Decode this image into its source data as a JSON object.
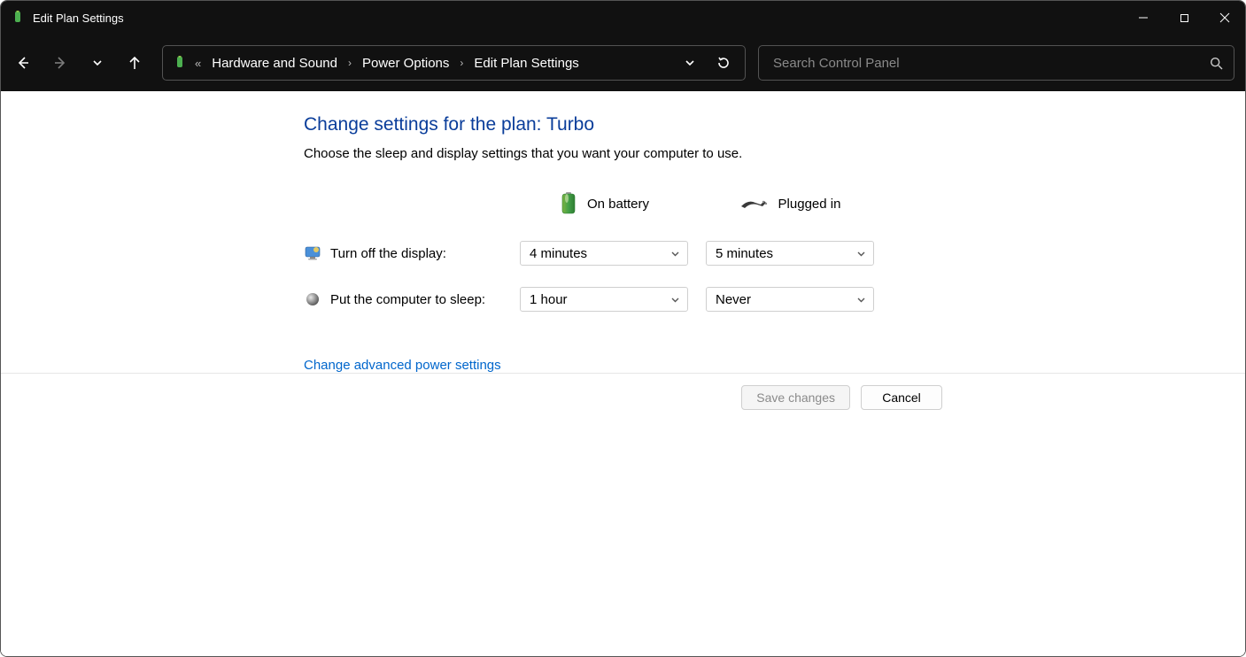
{
  "window": {
    "title": "Edit Plan Settings"
  },
  "breadcrumb": {
    "items": [
      "Hardware and Sound",
      "Power Options",
      "Edit Plan Settings"
    ]
  },
  "search": {
    "placeholder": "Search Control Panel"
  },
  "page": {
    "heading": "Change settings for the plan: Turbo",
    "description": "Choose the sleep and display settings that you want your computer to use.",
    "columns": {
      "battery": "On battery",
      "plugged": "Plugged in"
    },
    "rows": {
      "display": {
        "label": "Turn off the display:",
        "battery_value": "4 minutes",
        "plugged_value": "5 minutes"
      },
      "sleep": {
        "label": "Put the computer to sleep:",
        "battery_value": "1 hour",
        "plugged_value": "Never"
      }
    },
    "advanced_link": "Change advanced power settings"
  },
  "footer": {
    "save_label": "Save changes",
    "cancel_label": "Cancel"
  }
}
